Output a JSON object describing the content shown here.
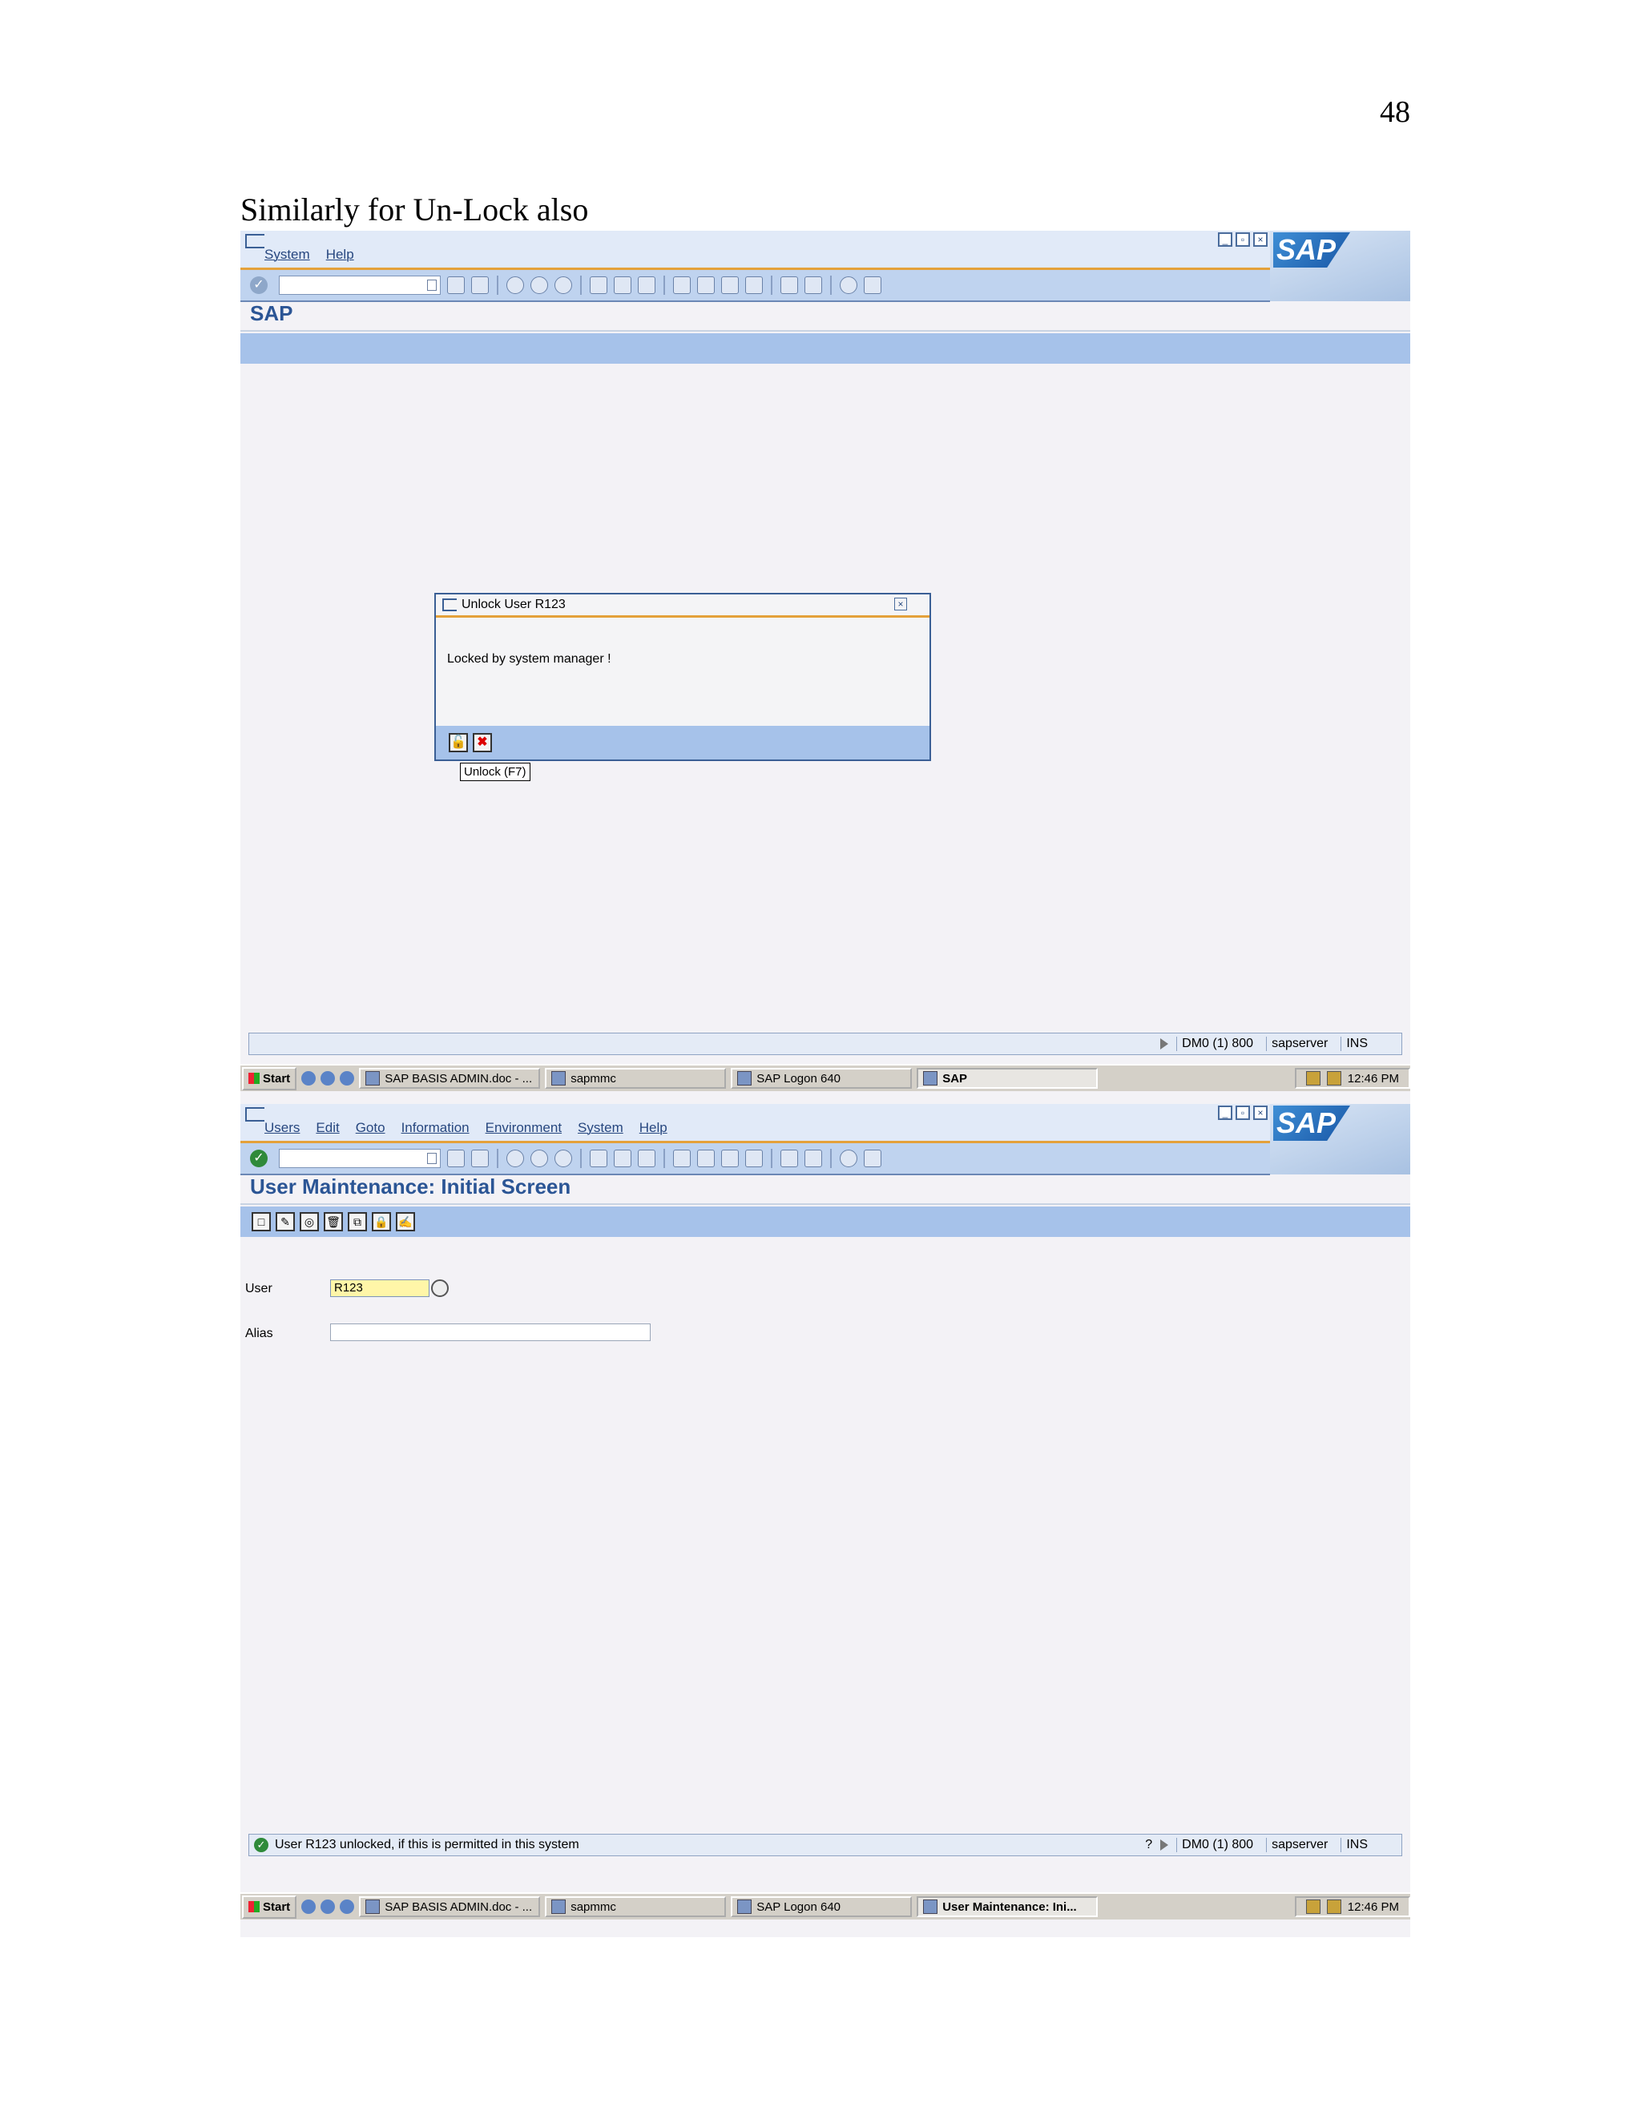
{
  "page": {
    "number": "48",
    "caption": "Similarly for Un-Lock also"
  },
  "screen1": {
    "menu": [
      "System",
      "Help"
    ],
    "logo_text": "SAP",
    "screen_title": "SAP",
    "dialog": {
      "title": "Unlock User R123",
      "message": "Locked by system manager !",
      "tooltip": "Unlock   (F7)"
    },
    "status": {
      "system": "DM0 (1) 800",
      "server": "sapserver",
      "mode": "INS"
    },
    "taskbar": {
      "start": "Start",
      "items": [
        "SAP BASIS ADMIN.doc - ...",
        "sapmmc",
        "SAP Logon 640",
        "SAP"
      ],
      "active_index": 3,
      "clock": "12:46 PM"
    }
  },
  "screen2": {
    "menu": [
      "Users",
      "Edit",
      "Goto",
      "Information",
      "Environment",
      "System",
      "Help"
    ],
    "logo_text": "SAP",
    "screen_title": "User Maintenance: Initial Screen",
    "form": {
      "user_label": "User",
      "user_value": "R123",
      "alias_label": "Alias",
      "alias_value": ""
    },
    "status": {
      "message": "User R123 unlocked, if this is permitted in this system",
      "system": "DM0 (1) 800",
      "server": "sapserver",
      "mode": "INS"
    },
    "taskbar": {
      "start": "Start",
      "items": [
        "SAP BASIS ADMIN.doc - ...",
        "sapmmc",
        "SAP Logon 640",
        "User Maintenance: Ini..."
      ],
      "active_index": 3,
      "clock": "12:46 PM"
    }
  },
  "colors": {
    "sap_blue": "#2b5595",
    "toolbar_blue": "#bfd3ef",
    "appbar_blue": "#a6c2ea",
    "accent_orange": "#e4a13a",
    "required_yellow": "#fff6a8"
  }
}
